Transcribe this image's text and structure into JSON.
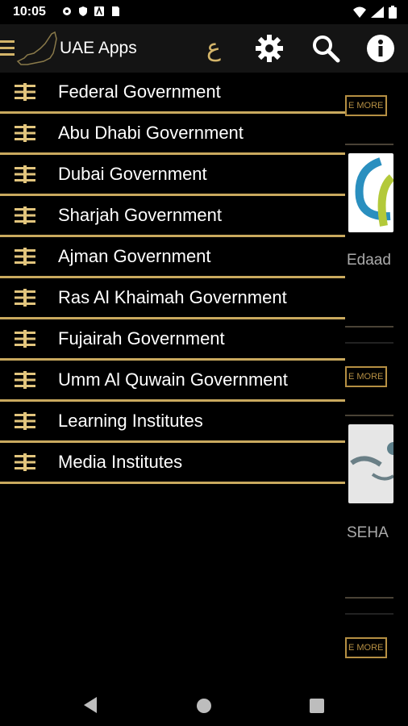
{
  "status_bar": {
    "time": "10:05",
    "left_icons": [
      "gear-icon",
      "shield-icon",
      "a-icon",
      "sim-icon"
    ],
    "right_icons": [
      "wifi-icon",
      "signal-icon",
      "battery-icon"
    ]
  },
  "app_bar": {
    "title": "UAE Apps",
    "arabic_label": "ع",
    "icons": [
      "menu-icon",
      "uae-map-logo",
      "arabic-language-icon",
      "gear-icon",
      "search-icon",
      "info-icon"
    ],
    "accent_color": "#d4b56a"
  },
  "drawer": {
    "items": [
      {
        "label": "Federal Government",
        "icon": "category-icon"
      },
      {
        "label": "Abu Dhabi Government",
        "icon": "category-icon"
      },
      {
        "label": "Dubai Government",
        "icon": "category-icon"
      },
      {
        "label": "Sharjah Government",
        "icon": "category-icon"
      },
      {
        "label": "Ajman Government",
        "icon": "category-icon"
      },
      {
        "label": "Ras Al Khaimah Government",
        "icon": "category-icon"
      },
      {
        "label": "Fujairah Government",
        "icon": "category-icon"
      },
      {
        "label": "Umm Al Quwain Government",
        "icon": "category-icon"
      },
      {
        "label": "Learning Institutes",
        "icon": "category-icon"
      },
      {
        "label": "Media Institutes",
        "icon": "category-icon"
      }
    ],
    "divider_color": "#c9a95e"
  },
  "background": {
    "more_label": "E MORE",
    "apps": [
      {
        "name": "Edaad"
      },
      {
        "name": "SEHA"
      }
    ]
  },
  "nav_bar": {
    "icons": [
      "back-icon",
      "home-icon",
      "recent-apps-icon"
    ]
  }
}
